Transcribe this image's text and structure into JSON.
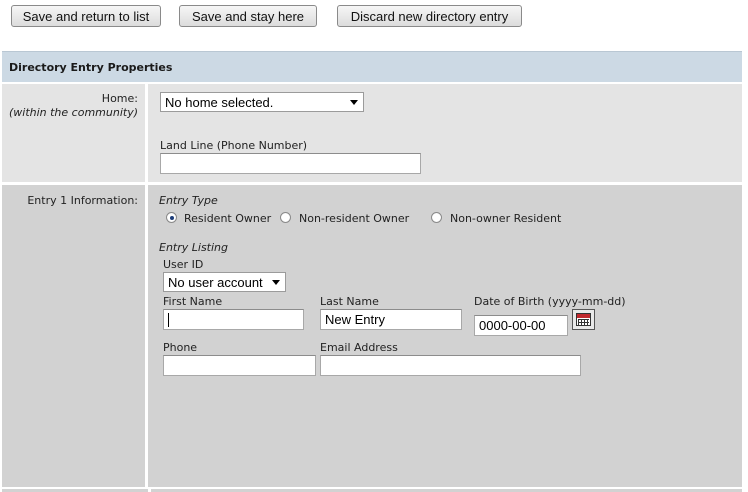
{
  "toolbar": {
    "save_return": "Save and return to list",
    "save_stay": "Save and stay here",
    "discard": "Discard new directory entry"
  },
  "section": {
    "title": "Directory Entry Properties"
  },
  "home": {
    "label": "Home:",
    "sublabel": "(within the community)",
    "select_value": "No home selected.",
    "landline_label": "Land Line (Phone Number)",
    "landline_value": ""
  },
  "entry": {
    "label": "Entry 1 Information:",
    "type_label": "Entry Type",
    "types": [
      "Resident Owner",
      "Non-resident Owner",
      "Non-owner Resident"
    ],
    "selected_type": "Resident Owner",
    "listing_label": "Entry Listing",
    "user_id_label": "User ID",
    "user_id_value": "No user account",
    "first_name_label": "First Name",
    "first_name_value": "",
    "last_name_label": "Last Name",
    "last_name_value": "New Entry",
    "dob_label": "Date of Birth (yyyy-mm-dd)",
    "dob_value": "0000-00-00",
    "phone_label": "Phone",
    "phone_value": "",
    "email_label": "Email Address",
    "email_value": ""
  },
  "icons": {
    "select_arrow": "chevron-down-icon",
    "calendar": "calendar-icon",
    "radio": "radio-button"
  }
}
